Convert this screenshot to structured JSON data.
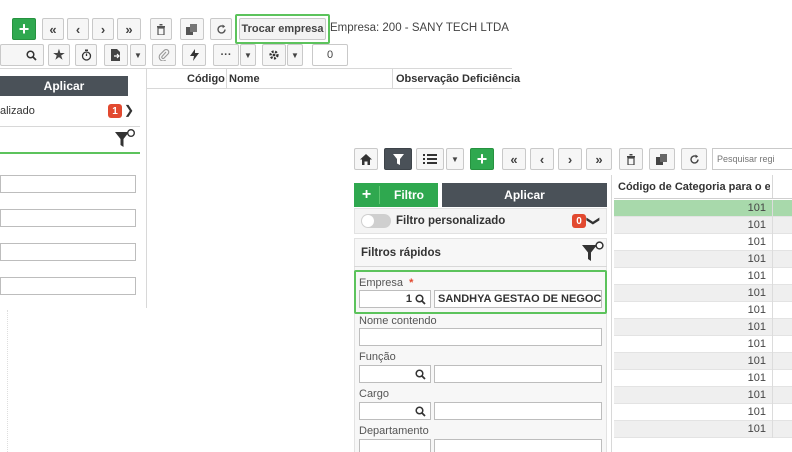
{
  "background": {
    "toolbar": {
      "trocar_label": "Trocar empresa",
      "empresa_text": "Empresa: 200 - SANY TECH LTDA",
      "counter": "0"
    },
    "filter": {
      "aplicar_label": "Aplicar",
      "personalizado_text": "alizado",
      "badge": "1"
    },
    "grid": {
      "columns": [
        "Código",
        "Nome",
        "Observação Deficiência"
      ]
    }
  },
  "overlay": {
    "toolbar": {
      "search_placeholder": "Pesquisar regi"
    },
    "filter": {
      "filtro_label": "Filtro",
      "aplicar_label": "Aplicar",
      "personalizado_label": "Filtro personalizado",
      "badge": "0",
      "rapidos_label": "Filtros rápidos",
      "fields": {
        "empresa_label": "Empresa",
        "empresa_required": "*",
        "empresa_code": "1",
        "empresa_name": "SANDHYA GESTAO DE NEGOC",
        "nome_label": "Nome contendo",
        "funcao_label": "Função",
        "cargo_label": "Cargo",
        "departamento_label": "Departamento"
      }
    },
    "grid": {
      "header": "Código de Categoria para o e",
      "rows": [
        "101",
        "101",
        "101",
        "101",
        "101",
        "101",
        "101",
        "101",
        "101",
        "101",
        "101",
        "101",
        "101",
        "101"
      ]
    }
  }
}
